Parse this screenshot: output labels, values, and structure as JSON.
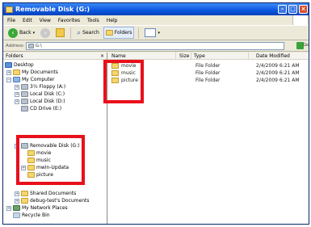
{
  "window": {
    "title": "Removable Disk (G:)"
  },
  "menu": [
    "File",
    "Edit",
    "View",
    "Favorites",
    "Tools",
    "Help"
  ],
  "toolbar": {
    "back_label": "Back",
    "search_label": "Search",
    "folders_label": "Folders"
  },
  "address": {
    "label": "Address",
    "value": "G:\\",
    "go_label": "Go"
  },
  "folders_pane": {
    "header": "Folders",
    "close_glyph": "×",
    "tree": [
      {
        "label": "Desktop",
        "icon": "desktop-icon"
      },
      {
        "label": "My Documents",
        "icon": "folder-icon",
        "expander": "+"
      },
      {
        "label": "My Computer",
        "icon": "computer-icon",
        "expander": "−"
      },
      {
        "label": "3½ Floppy (A:)",
        "icon": "floppy-icon",
        "expander": "+"
      },
      {
        "label": "Local Disk (C:)",
        "icon": "drive-icon",
        "expander": "+"
      },
      {
        "label": "Local Disk (D:)",
        "icon": "drive-icon",
        "expander": "+"
      },
      {
        "label": "CD Drive (E:)",
        "icon": "cd-icon"
      },
      {
        "label": "Removable Disk (G:)",
        "icon": "drive-icon",
        "expander": "−"
      },
      {
        "label": "movie",
        "icon": "folder-icon"
      },
      {
        "label": "music",
        "icon": "folder-icon"
      },
      {
        "label": "mwin-Updata",
        "icon": "folder-icon",
        "expander": "+"
      },
      {
        "label": "picture",
        "icon": "folder-icon"
      },
      {
        "label": "Shared Documents",
        "icon": "folder-icon",
        "expander": "+"
      },
      {
        "label": "debug-test's Documents",
        "icon": "folder-icon",
        "expander": "+"
      },
      {
        "label": "My Network Places",
        "icon": "network-icon",
        "expander": "+"
      },
      {
        "label": "Recycle Bin",
        "icon": "recycle-bin-icon"
      }
    ]
  },
  "files_pane": {
    "columns": {
      "name": "Name",
      "size": "Size",
      "type": "Type",
      "date": "Date Modified"
    },
    "rows": [
      {
        "name": "movie",
        "size": "",
        "type": "File Folder",
        "date": "2/4/2009 6:21 AM"
      },
      {
        "name": "music",
        "size": "",
        "type": "File Folder",
        "date": "2/4/2009 6:21 AM"
      },
      {
        "name": "picture",
        "size": "",
        "type": "File Folder",
        "date": "2/4/2009 6:21 AM"
      }
    ]
  },
  "highlight_color": "#e8101b"
}
